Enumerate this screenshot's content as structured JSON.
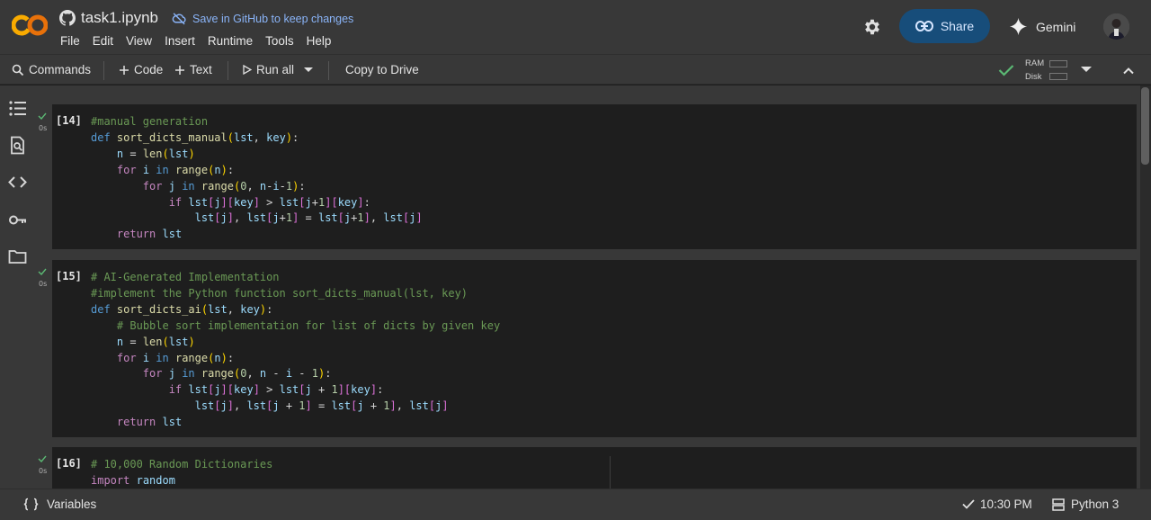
{
  "header": {
    "notebook_name": "task1.ipynb",
    "save_link": "Save in GitHub to keep changes",
    "menu": [
      "File",
      "Edit",
      "View",
      "Insert",
      "Runtime",
      "Tools",
      "Help"
    ],
    "share_label": "Share",
    "gemini_label": "Gemini",
    "logo_text": "CO"
  },
  "toolbar": {
    "commands": "Commands",
    "add_code": "Code",
    "add_text": "Text",
    "run_all": "Run all",
    "copy_to_drive": "Copy to Drive",
    "ram_label": "RAM",
    "disk_label": "Disk"
  },
  "cells": [
    {
      "count": "[14]",
      "time": "0s",
      "lines": [
        "#manual generation",
        "def sort_dicts_manual(lst, key):",
        "    n = len(lst)",
        "    for i in range(n):",
        "        for j in range(0, n-i-1):",
        "            if lst[j][key] > lst[j+1][key]:",
        "                lst[j], lst[j+1] = lst[j+1], lst[j]",
        "    return lst"
      ]
    },
    {
      "count": "[15]",
      "time": "0s",
      "lines": [
        "# AI-Generated Implementation",
        "#implement the Python function sort_dicts_manual(lst, key)",
        "def sort_dicts_ai(lst, key):",
        "    # Bubble sort implementation for list of dicts by given key",
        "    n = len(lst)",
        "    for i in range(n):",
        "        for j in range(0, n - i - 1):",
        "            if lst[j][key] > lst[j + 1][key]:",
        "                lst[j], lst[j + 1] = lst[j + 1], lst[j]",
        "    return lst"
      ]
    },
    {
      "count": "[16]",
      "time": "0s",
      "lines": [
        "# 10,000 Random Dictionaries",
        "import random"
      ]
    }
  ],
  "status": {
    "variables": "Variables",
    "time": "10:30 PM",
    "kernel": "Python 3"
  },
  "colors": {
    "accent_blue": "#8ab4f8",
    "success_green": "#5bb974",
    "logo_orange": "#f9ab00"
  }
}
